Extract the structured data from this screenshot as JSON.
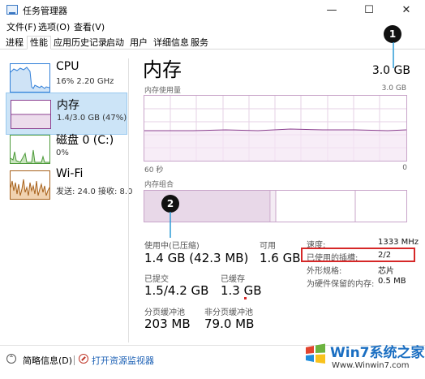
{
  "window": {
    "title": "任务管理器",
    "buttons": [
      "—",
      "☐",
      "✕"
    ]
  },
  "menu": [
    "文件(F)",
    "选项(O)",
    "查看(V)"
  ],
  "tabs": [
    "进程",
    "性能",
    "应用历史记录",
    "启动",
    "用户",
    "详细信息",
    "服务"
  ],
  "active_tab": "性能",
  "sidebar": {
    "items": [
      {
        "name": "CPU",
        "sub": "16% 2.20 GHz",
        "color": "#2f7ed8"
      },
      {
        "name": "内存",
        "sub": "1.4/3.0 GB (47%)",
        "color": "#8b3f8f"
      },
      {
        "name": "磁盘 0 (C:)",
        "sub": "0%",
        "color": "#4d9a3a"
      },
      {
        "name": "Wi-Fi",
        "sub": "发送: 24.0  接收: 8.0",
        "color": "#a7611b"
      }
    ]
  },
  "main": {
    "title": "内存",
    "total": "3.0 GB",
    "usage_label": "内存使用量",
    "usage_max": "3.0 GB",
    "axis_left": "60 秒",
    "axis_right": "0",
    "composition_label": "内存组合",
    "stats": {
      "in_use_label": "使用中(已压缩)",
      "in_use_value": "1.4 GB (42.3 MB)",
      "available_label": "可用",
      "available_value": "1.6 GB",
      "committed_label": "已提交",
      "committed_value": "1.5/4.2 GB",
      "cached_label": "已缓存",
      "cached_value": "1.3 GB",
      "paged_label": "分页缓冲池",
      "paged_value": "203 MB",
      "nonpaged_label": "非分页缓冲池",
      "nonpaged_value": "79.0 MB"
    },
    "right": {
      "speed_label": "速度:",
      "speed_value": "1333 MHz",
      "slots_label": "已使用的插槽:",
      "slots_value": "2/2",
      "form_label": "外形规格:",
      "form_value": "芯片",
      "reserved_label": "为硬件保留的内存:",
      "reserved_value": "0.5 MB"
    }
  },
  "annotations": {
    "badge1": "1",
    "badge2": "2"
  },
  "footer": {
    "brief": "简略信息(D)",
    "monitor": "打开资源监视器"
  },
  "watermark": {
    "brand": "Win7系统之家",
    "url": "Www.Winwin7.com"
  },
  "accent": "#8b3f8f"
}
